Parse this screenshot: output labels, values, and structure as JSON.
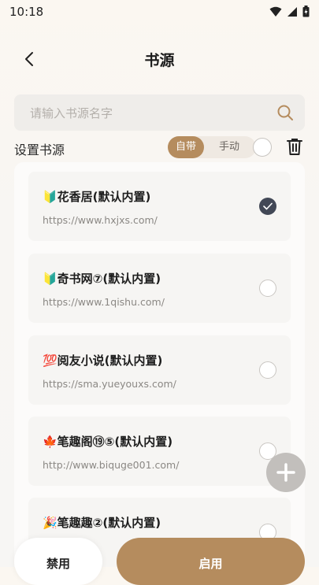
{
  "status_bar": {
    "time": "10:18"
  },
  "header": {
    "title": "书源"
  },
  "search": {
    "placeholder": "请输入书源名字",
    "value": ""
  },
  "filter": {
    "label": "设置书源",
    "modes": [
      {
        "label": "自带",
        "active": true
      },
      {
        "label": "手动",
        "active": false
      }
    ]
  },
  "sources": [
    {
      "name": "🔰花香居(默认内置)",
      "url": "https://www.hxjxs.com/",
      "selected": true
    },
    {
      "name": "🔰奇书网⑦(默认内置)",
      "url": "https://www.1qishu.com/",
      "selected": false
    },
    {
      "name": "💯阅友小说(默认内置)",
      "url": "https://sma.yueyouxs.com/",
      "selected": false
    },
    {
      "name": "🍁笔趣阁⑲⑤(默认内置)",
      "url": "http://www.biquge001.com/",
      "selected": false
    },
    {
      "name": "🎉笔趣趣②(默认内置)",
      "url": "",
      "selected": false
    }
  ],
  "actions": {
    "disable_label": "禁用",
    "enable_label": "启用"
  },
  "icons": [
    "back-arrow-icon",
    "search-icon",
    "trash-icon",
    "check-icon",
    "plus-icon",
    "wifi-icon",
    "signal-icon",
    "battery-icon"
  ],
  "colors": {
    "accent": "#b58c5e",
    "checked": "#424856",
    "fab": "#c2bfbc"
  }
}
